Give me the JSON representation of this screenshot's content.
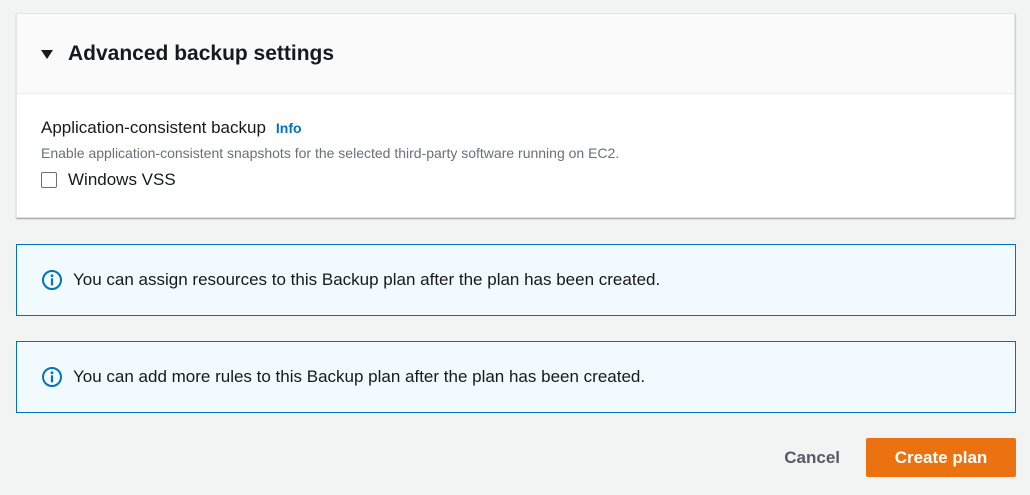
{
  "advanced": {
    "title": "Advanced backup settings",
    "expanded": true,
    "field_label": "Application-consistent backup",
    "info_label": "Info",
    "description": "Enable application-consistent snapshots for the selected third-party software running on EC2.",
    "checkbox_label": "Windows VSS",
    "checkbox_checked": false
  },
  "alerts": [
    {
      "icon": "info-icon",
      "text": "You can assign resources to this Backup plan after the plan has been created."
    },
    {
      "icon": "info-icon",
      "text": "You can add more rules to this Backup plan after the plan has been created."
    }
  ],
  "actions": {
    "cancel_label": "Cancel",
    "create_label": "Create plan"
  },
  "colors": {
    "primary_button": "#ec7211",
    "link": "#0073bb",
    "alert_border": "#0073bb",
    "alert_background": "#f1faff"
  }
}
